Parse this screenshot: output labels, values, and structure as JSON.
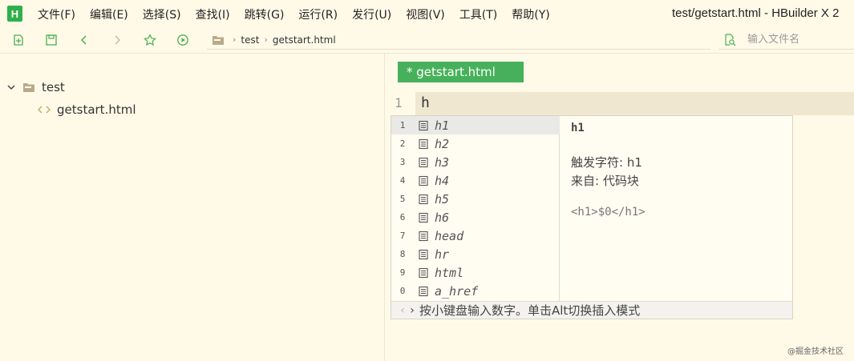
{
  "app": {
    "logo_letter": "H",
    "window_title": "test/getstart.html - HBuilder X 2",
    "brand_color": "#2fb04a"
  },
  "menu": {
    "items": [
      {
        "label": "文件(F)"
      },
      {
        "label": "编辑(E)"
      },
      {
        "label": "选择(S)"
      },
      {
        "label": "查找(I)"
      },
      {
        "label": "跳转(G)"
      },
      {
        "label": "运行(R)"
      },
      {
        "label": "发行(U)"
      },
      {
        "label": "视图(V)"
      },
      {
        "label": "工具(T)"
      },
      {
        "label": "帮助(Y)"
      }
    ]
  },
  "toolbar": {
    "icons": [
      "new-file-icon",
      "save-icon",
      "back-icon",
      "forward-icon",
      "favorite-star-icon",
      "run-icon"
    ],
    "breadcrumb": {
      "project": "test",
      "file": "getstart.html",
      "separator": "›"
    },
    "file_search_placeholder": "输入文件名"
  },
  "sidebar": {
    "project": {
      "name": "test",
      "expanded": true
    },
    "files": [
      {
        "name": "getstart.html",
        "icon": "html-code-icon"
      }
    ]
  },
  "editor": {
    "tab_label": "* getstart.html",
    "tab_color": "#46b15a",
    "line_number": "1",
    "code": "h"
  },
  "autocomplete": {
    "selected_index": 0,
    "items": [
      {
        "num": "1",
        "label": "h1"
      },
      {
        "num": "2",
        "label": "h2"
      },
      {
        "num": "3",
        "label": "h3"
      },
      {
        "num": "4",
        "label": "h4"
      },
      {
        "num": "5",
        "label": "h5"
      },
      {
        "num": "6",
        "label": "h6"
      },
      {
        "num": "7",
        "label": "head"
      },
      {
        "num": "8",
        "label": "hr"
      },
      {
        "num": "9",
        "label": "html"
      },
      {
        "num": "0",
        "label": "a_href"
      }
    ],
    "detail": {
      "title": "h1",
      "trigger": "触发字符: h1",
      "source": "来自: 代码块",
      "snippet": "<h1>$0</h1>"
    },
    "footer": {
      "prev_arrow": "‹",
      "next_arrow": "›",
      "hint": "按小键盘输入数字。单击Alt切换插入模式"
    }
  },
  "watermark": "@掘金技术社区"
}
